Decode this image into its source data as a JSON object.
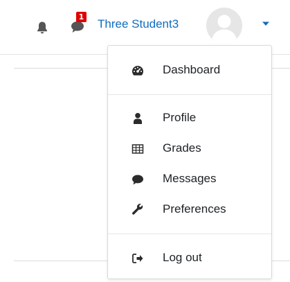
{
  "header": {
    "user_name": "Three Student3",
    "notification_count": "1",
    "icons": {
      "notifications": "bell-icon",
      "messages": "message-bubble-icon",
      "avatar": "user-avatar",
      "menu_toggle": "caret-down-icon"
    }
  },
  "menu": {
    "items": [
      {
        "label": "Dashboard",
        "icon": "dashboard-gauge-icon"
      },
      {
        "label": "Profile",
        "icon": "user-icon"
      },
      {
        "label": "Grades",
        "icon": "table-grid-icon"
      },
      {
        "label": "Messages",
        "icon": "comment-icon"
      },
      {
        "label": "Preferences",
        "icon": "wrench-icon"
      },
      {
        "label": "Log out",
        "icon": "sign-out-icon"
      }
    ]
  },
  "colors": {
    "link": "#0f6cbf",
    "text": "#1d2125",
    "icon": "#333333",
    "badge": "#e00000"
  }
}
